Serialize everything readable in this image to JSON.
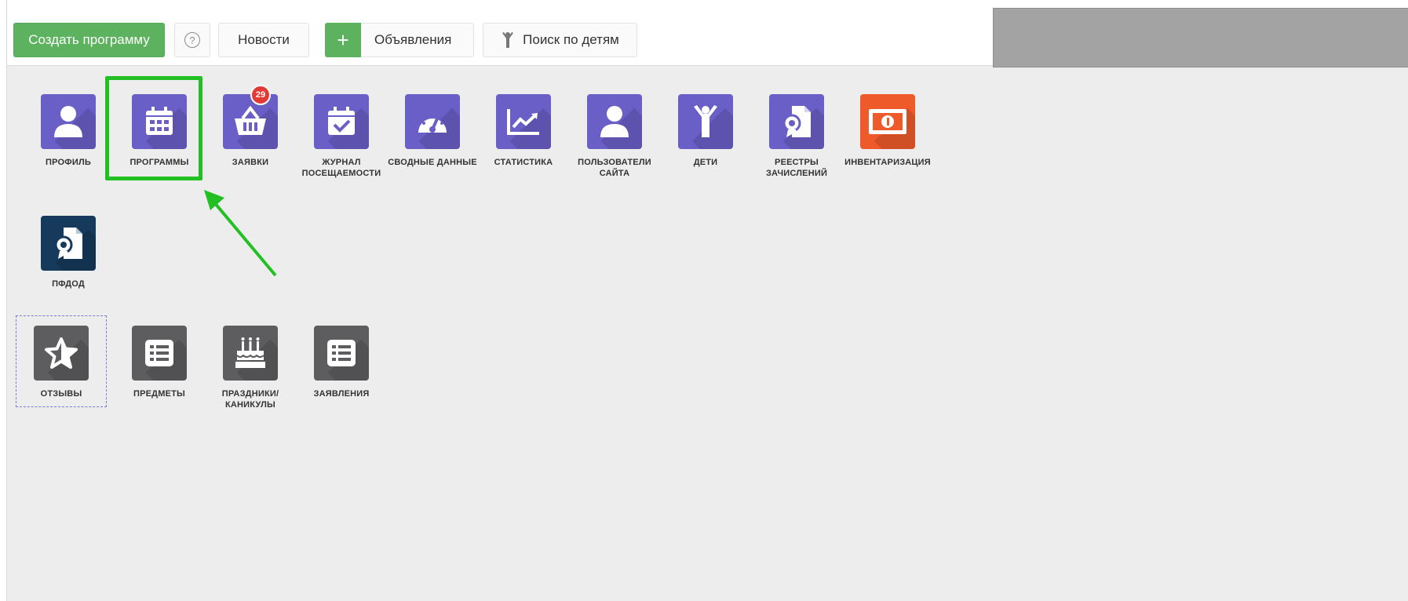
{
  "toolbar": {
    "create_label": "Создать программу",
    "help_glyph": "?",
    "news_label": "Новости",
    "ads_label": "Объявления",
    "ads_plus": "+",
    "kids_search_label": "Поиск по детям"
  },
  "tiles_row1": [
    {
      "label": "ПРОФИЛЬ",
      "icon": "user-icon"
    },
    {
      "label": "ПРОГРАММЫ",
      "icon": "calendar-icon"
    },
    {
      "label": "ЗАЯВКИ",
      "icon": "basket-icon",
      "badge": "29"
    },
    {
      "label": "ЖУРНАЛ ПОСЕЩАЕМОСТИ",
      "icon": "calendar-check-icon"
    },
    {
      "label": "СВОДНЫЕ ДАННЫЕ",
      "icon": "gauge-icon"
    },
    {
      "label": "СТАТИСТИКА",
      "icon": "chart-icon"
    },
    {
      "label": "ПОЛЬЗОВАТЕЛИ САЙТА",
      "icon": "user-icon"
    },
    {
      "label": "ДЕТИ",
      "icon": "child-icon"
    },
    {
      "label": "РЕЕСТРЫ ЗАЧИСЛЕНИЙ",
      "icon": "certificate-icon"
    },
    {
      "label": "ИНВЕНТАРИЗАЦИЯ",
      "icon": "money-icon"
    }
  ],
  "tiles_row2": [
    {
      "label": "ПФДОД",
      "icon": "certificate-icon"
    }
  ],
  "tiles_row3": [
    {
      "label": "ОТЗЫВЫ",
      "icon": "star-icon"
    },
    {
      "label": "ПРЕДМЕТЫ",
      "icon": "list-icon"
    },
    {
      "label": "ПРАЗДНИКИ/ КАНИКУЛЫ",
      "icon": "cake-icon"
    },
    {
      "label": "ЗАЯВЛЕНИЯ",
      "icon": "list-icon"
    }
  ],
  "colors": {
    "accent_green": "#5cb25e",
    "tile_purple": "#6a5fc7",
    "tile_orange": "#ee5a2a",
    "tile_navy": "#163a5c",
    "tile_grey": "#5d5d5f",
    "highlight_green": "#22c022",
    "badge_red": "#e53935"
  }
}
